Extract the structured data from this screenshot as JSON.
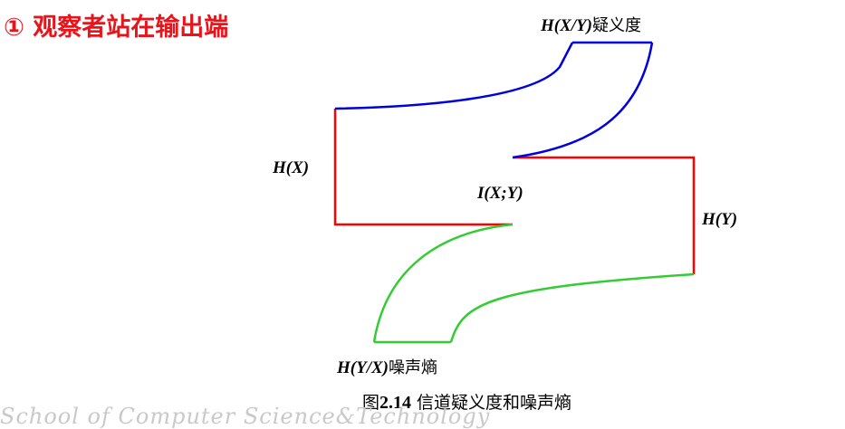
{
  "slide": {
    "title": "① 观察者站在输出端"
  },
  "labels": {
    "hxy_cond": {
      "expr": "H(X/Y)",
      "cn": "疑义度"
    },
    "hx": {
      "expr": "H(X)"
    },
    "ixy": {
      "expr": "I(X;Y)"
    },
    "hy": {
      "expr": "H(Y)"
    },
    "hyx_cond": {
      "expr": "H(Y/X)",
      "cn": "噪声熵"
    }
  },
  "caption": {
    "prefix": "图",
    "number": "2.14",
    "text": " 信道疑义度和噪声熵"
  },
  "footer": {
    "school": "School of Computer Science&Technology"
  },
  "colors": {
    "title": "#e8141b",
    "red_line": "#ff0000",
    "blue_curve": "#0000dd",
    "green_curve": "#33cc33"
  }
}
